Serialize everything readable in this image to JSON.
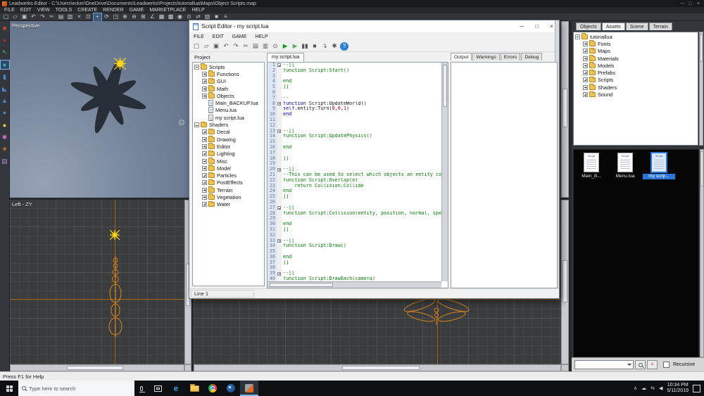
{
  "theme": {
    "accent": "#2f80d2",
    "wire": "#d9821c",
    "wire-dim": "#a06414",
    "sun": "#ffd61a",
    "comment": "#007a00",
    "keyword": "#0000a8",
    "number": "#b80000",
    "model": "#242a33"
  },
  "app": {
    "title": "Leadwerks Editor - C:\\Users\\ecker\\OneDrive\\Documents\\Leadwerks\\Projects\\tutoriallua\\Maps\\Object Scripts.map",
    "menu": [
      "FILE",
      "EDIT",
      "VIEW",
      "TOOLS",
      "CREATE",
      "RENDER",
      "GAME",
      "MARKETPLACE",
      "HELP"
    ],
    "window_controls": {
      "minimize": "─",
      "maximize": "□",
      "close": "×"
    },
    "status": "Press F1 for Help",
    "toolbar": [
      {
        "name": "new-icon",
        "glyph": "▢"
      },
      {
        "name": "open-icon",
        "glyph": "▱"
      },
      {
        "name": "save-icon",
        "glyph": "▣"
      },
      {
        "name": "undo-icon",
        "glyph": "↶"
      },
      {
        "name": "redo-icon",
        "glyph": "↷"
      },
      {
        "name": "cut-icon",
        "glyph": "✂"
      },
      {
        "name": "copy-icon",
        "glyph": "▤"
      },
      {
        "name": "paste-icon",
        "glyph": "▥"
      },
      {
        "name": "delete-icon",
        "glyph": "×"
      },
      {
        "name": "select-tool-icon",
        "glyph": "⊡"
      },
      {
        "name": "translate-tool-icon",
        "glyph": "+",
        "cls": "active"
      },
      {
        "name": "rotate-tool-icon",
        "glyph": "⟳"
      },
      {
        "name": "scale-tool-icon",
        "glyph": "◳"
      },
      {
        "name": "csg-add-icon",
        "glyph": "⊕"
      },
      {
        "name": "csg-subtract-icon",
        "glyph": "⊖"
      },
      {
        "name": "grid-snap-icon",
        "glyph": "⊞"
      },
      {
        "name": "angle-snap-icon",
        "glyph": "∠"
      },
      {
        "name": "grid-decrease-icon",
        "glyph": "▦"
      },
      {
        "name": "grid-increase-icon",
        "glyph": "▩"
      },
      {
        "name": "camera-tool-icon",
        "glyph": "◉"
      },
      {
        "name": "zoom-tool-icon",
        "glyph": "⊙"
      },
      {
        "name": "pan-tool-icon",
        "glyph": "⇄"
      },
      {
        "name": "wireframe-view-icon",
        "glyph": "▧"
      },
      {
        "name": "solid-view-icon",
        "glyph": "■"
      },
      {
        "name": "options-icon",
        "glyph": "≡"
      }
    ],
    "side_tools": [
      {
        "name": "create-box-tool",
        "glyph": "■",
        "color": "#c0453a"
      },
      {
        "name": "create-sphere-tool",
        "glyph": "●",
        "color": "#a33327"
      },
      {
        "name": "move-tool",
        "glyph": "↖",
        "color": "#49c46a"
      },
      {
        "name": "select-ball-tool",
        "glyph": "●",
        "color": "#35b6c9",
        "cls": "active"
      },
      {
        "name": "create-cylinder-tool",
        "glyph": "▮",
        "color": "#4a86d8"
      },
      {
        "name": "create-wedge-tool",
        "glyph": "◣",
        "color": "#4a86d8"
      },
      {
        "name": "create-cone-tool",
        "glyph": "▲",
        "color": "#4a86d8"
      },
      {
        "name": "create-capsule-tool",
        "glyph": "●",
        "color": "#4a86d8"
      },
      {
        "name": "create-light-tool",
        "glyph": "●",
        "color": "#f5d442"
      },
      {
        "name": "create-emitter-tool",
        "glyph": "✱",
        "color": "#d06cd0"
      },
      {
        "name": "create-sun-tool",
        "glyph": "☀",
        "color": "#f09030"
      },
      {
        "name": "attach-script-tool",
        "glyph": "▤",
        "color": "#b48ae0"
      }
    ]
  },
  "viewports": {
    "perspective_label": "Perspective",
    "left_label": "Left - ZY"
  },
  "script_editor": {
    "title": "Script Editor - my script.lua",
    "menu": [
      "FILE",
      "EDIT",
      "GAME",
      "HELP"
    ],
    "controls": {
      "minimize": "─",
      "maximize": "□",
      "close": "×"
    },
    "toolbar": [
      {
        "name": "new-script-icon",
        "glyph": "▢"
      },
      {
        "name": "open-script-icon",
        "glyph": "▱"
      },
      {
        "name": "save-script-icon",
        "glyph": "▣"
      },
      {
        "name": "undo-icon",
        "glyph": "↶"
      },
      {
        "name": "redo-icon",
        "glyph": "↷"
      },
      {
        "name": "cut-icon",
        "glyph": "✂"
      },
      {
        "name": "copy-icon",
        "glyph": "▤"
      },
      {
        "name": "paste-icon",
        "glyph": "▥"
      },
      {
        "name": "find-icon",
        "glyph": "⊙"
      },
      {
        "name": "run-icon",
        "glyph": "▶",
        "color": "#129612"
      },
      {
        "name": "debug-run-icon",
        "glyph": "▶",
        "color": "#51b651"
      },
      {
        "name": "pause-icon",
        "glyph": "▮▮",
        "color": "#555555"
      },
      {
        "name": "stop-icon",
        "glyph": "■",
        "color": "#555555"
      },
      {
        "name": "step-icon",
        "glyph": "↴",
        "color": "#50555c"
      },
      {
        "name": "options-gear-icon",
        "glyph": "✱",
        "color": "#50555c"
      },
      {
        "name": "help-icon",
        "glyph": "?",
        "cls": "round",
        "color": "#ffffff"
      }
    ],
    "project_panel": {
      "header": "Project",
      "tree": [
        {
          "label": "Scripts",
          "icon": "folder",
          "exp": "minus",
          "ind": "ind0"
        },
        {
          "label": "Functions",
          "icon": "folder",
          "exp": "plus",
          "ind": "ind1"
        },
        {
          "label": "GUI",
          "icon": "folder",
          "exp": "plus",
          "ind": "ind1"
        },
        {
          "label": "Math",
          "icon": "folder",
          "exp": "plus",
          "ind": "ind1"
        },
        {
          "label": "Objects",
          "icon": "folder",
          "exp": "plus",
          "ind": "ind1"
        },
        {
          "label": "Main_BACKUP.lua",
          "icon": "file",
          "exp": "none",
          "ind": "ind1"
        },
        {
          "label": "Menu.lua",
          "icon": "file",
          "exp": "none",
          "ind": "ind1"
        },
        {
          "label": "my script.lua",
          "icon": "file",
          "exp": "none",
          "ind": "ind1"
        },
        {
          "label": "Shaders",
          "icon": "folder",
          "exp": "minus",
          "ind": "ind0"
        },
        {
          "label": "Decal",
          "icon": "folder",
          "exp": "plus",
          "ind": "ind1"
        },
        {
          "label": "Drawing",
          "icon": "folder",
          "exp": "plus",
          "ind": "ind1"
        },
        {
          "label": "Editor",
          "icon": "folder",
          "exp": "plus",
          "ind": "ind1"
        },
        {
          "label": "Lighting",
          "icon": "folder",
          "exp": "plus",
          "ind": "ind1"
        },
        {
          "label": "Misc",
          "icon": "folder",
          "exp": "plus",
          "ind": "ind1"
        },
        {
          "label": "Model",
          "icon": "folder",
          "exp": "plus",
          "ind": "ind1"
        },
        {
          "label": "Particles",
          "icon": "folder",
          "exp": "plus",
          "ind": "ind1"
        },
        {
          "label": "PostEffects",
          "icon": "folder",
          "exp": "plus",
          "ind": "ind1"
        },
        {
          "label": "Terrain",
          "icon": "folder",
          "exp": "plus",
          "ind": "ind1"
        },
        {
          "label": "Vegetation",
          "icon": "folder",
          "exp": "plus",
          "ind": "ind1"
        },
        {
          "label": "Water",
          "icon": "folder",
          "exp": "plus",
          "ind": "ind1"
        }
      ]
    },
    "tab": "my script.lua",
    "output_tabs": [
      {
        "label": "Output",
        "cls": "active"
      },
      {
        "label": "Warnings",
        "cls": ""
      },
      {
        "label": "Errors",
        "cls": ""
      },
      {
        "label": "Debug",
        "cls": ""
      }
    ],
    "status": "Line 1",
    "code": {
      "lines": [
        {
          "n": 1,
          "fold": true,
          "seg": [
            {
              "c": "cm",
              "t": "--[["
            }
          ]
        },
        {
          "n": 2,
          "seg": [
            {
              "c": "cm",
              "t": "function Script:Start()"
            }
          ]
        },
        {
          "n": 3,
          "seg": []
        },
        {
          "n": 4,
          "seg": [
            {
              "c": "cm",
              "t": "end"
            }
          ]
        },
        {
          "n": 5,
          "seg": [
            {
              "c": "cm",
              "t": "]]"
            }
          ]
        },
        {
          "n": 6,
          "seg": []
        },
        {
          "n": 7,
          "seg": [
            {
              "c": "cm",
              "t": "--"
            }
          ]
        },
        {
          "n": 8,
          "fold": true,
          "seg": [
            {
              "c": "kw",
              "t": "function"
            },
            {
              "c": "pl",
              "t": " Script:UpdateWorld()"
            }
          ]
        },
        {
          "n": 9,
          "seg": [
            {
              "c": "kw",
              "t": "self"
            },
            {
              "c": "pl",
              "t": ".entity:Turn("
            },
            {
              "c": "nm",
              "t": "0"
            },
            {
              "c": "pl",
              "t": ","
            },
            {
              "c": "nm",
              "t": "0"
            },
            {
              "c": "pl",
              "t": ","
            },
            {
              "c": "nm",
              "t": "1"
            },
            {
              "c": "pl",
              "t": ")"
            }
          ]
        },
        {
          "n": 10,
          "seg": [
            {
              "c": "kw",
              "t": "end"
            }
          ]
        },
        {
          "n": 11,
          "seg": []
        },
        {
          "n": 12,
          "seg": []
        },
        {
          "n": 13,
          "fold": true,
          "seg": [
            {
              "c": "cm",
              "t": "--[["
            }
          ]
        },
        {
          "n": 14,
          "seg": [
            {
              "c": "cm",
              "t": "function Script:UpdatePhysics()"
            }
          ]
        },
        {
          "n": 15,
          "seg": []
        },
        {
          "n": 16,
          "seg": [
            {
              "c": "cm",
              "t": "end"
            }
          ]
        },
        {
          "n": 17,
          "seg": []
        },
        {
          "n": 18,
          "seg": [
            {
              "c": "cm",
              "t": "]]"
            }
          ]
        },
        {
          "n": 19,
          "seg": []
        },
        {
          "n": 20,
          "fold": true,
          "seg": [
            {
              "c": "cm",
              "t": "--[["
            }
          ]
        },
        {
          "n": 21,
          "seg": [
            {
              "c": "cm",
              "t": "--This can be used to select which objects an entity col"
            }
          ]
        },
        {
          "n": 22,
          "seg": [
            {
              "c": "cm",
              "t": "function Script:Overlap(e)"
            }
          ]
        },
        {
          "n": 23,
          "seg": [
            {
              "c": "cm",
              "t": "    return Collision:Collide"
            }
          ]
        },
        {
          "n": 24,
          "seg": [
            {
              "c": "cm",
              "t": "end"
            }
          ]
        },
        {
          "n": 25,
          "seg": [
            {
              "c": "cm",
              "t": "]]"
            }
          ]
        },
        {
          "n": 26,
          "seg": []
        },
        {
          "n": 27,
          "fold": true,
          "seg": [
            {
              "c": "cm",
              "t": "--[["
            }
          ]
        },
        {
          "n": 28,
          "seg": [
            {
              "c": "cm",
              "t": "function Script:Collision(entity, position, normal, spee"
            }
          ]
        },
        {
          "n": 29,
          "seg": []
        },
        {
          "n": 30,
          "seg": [
            {
              "c": "cm",
              "t": "end"
            }
          ]
        },
        {
          "n": 31,
          "seg": [
            {
              "c": "cm",
              "t": "]]"
            }
          ]
        },
        {
          "n": 32,
          "seg": []
        },
        {
          "n": 33,
          "fold": true,
          "seg": [
            {
              "c": "cm",
              "t": "--[["
            }
          ]
        },
        {
          "n": 34,
          "seg": [
            {
              "c": "cm",
              "t": "function Script:Draw()"
            }
          ]
        },
        {
          "n": 35,
          "seg": []
        },
        {
          "n": 36,
          "seg": [
            {
              "c": "cm",
              "t": "end"
            }
          ]
        },
        {
          "n": 37,
          "seg": [
            {
              "c": "cm",
              "t": "]]"
            }
          ]
        },
        {
          "n": 38,
          "seg": []
        },
        {
          "n": 39,
          "fold": true,
          "seg": [
            {
              "c": "cm",
              "t": "--[["
            }
          ]
        },
        {
          "n": 40,
          "seg": [
            {
              "c": "cm",
              "t": "function Script:DrawEach(camera)"
            }
          ]
        }
      ]
    }
  },
  "assets_panel": {
    "tabs": [
      {
        "label": "Objects",
        "cls": ""
      },
      {
        "label": "Assets",
        "cls": "active"
      },
      {
        "label": "Scene",
        "cls": ""
      },
      {
        "label": "Terrain",
        "cls": ""
      }
    ],
    "tree": [
      {
        "label": "tutoriallua",
        "icon": "folder-open",
        "exp": "minus",
        "ind": "ind0"
      },
      {
        "label": "Fonts",
        "icon": "folder",
        "exp": "plus",
        "ind": "ind1"
      },
      {
        "label": "Maps",
        "icon": "folder",
        "exp": "plus",
        "ind": "ind1"
      },
      {
        "label": "Materials",
        "icon": "folder",
        "exp": "plus",
        "ind": "ind1"
      },
      {
        "label": "Models",
        "icon": "folder",
        "exp": "plus",
        "ind": "ind1"
      },
      {
        "label": "Prefabs",
        "icon": "folder",
        "exp": "plus",
        "ind": "ind1"
      },
      {
        "label": "Scripts",
        "icon": "folder",
        "exp": "plus",
        "ind": "ind1"
      },
      {
        "label": "Shaders",
        "icon": "folder",
        "exp": "plus",
        "ind": "ind1"
      },
      {
        "label": "Sound",
        "icon": "folder",
        "exp": "plus",
        "ind": "ind1"
      }
    ],
    "files": [
      {
        "label": "Main_B...",
        "kind": "Script",
        "cls": ""
      },
      {
        "label": "Menu.lua",
        "kind": "Script",
        "cls": ""
      },
      {
        "label": "my scrip...",
        "kind": "Script",
        "cls": "selected"
      }
    ],
    "search_value": "",
    "recursive_label": "Recursive"
  },
  "taskbar": {
    "search_placeholder": "Type here to search",
    "tray_icons": [
      {
        "name": "tray-chevron-icon",
        "glyph": "∧"
      },
      {
        "name": "onedrive-icon",
        "glyph": "☁"
      },
      {
        "name": "network-icon",
        "glyph": "⇆"
      },
      {
        "name": "volume-icon",
        "glyph": "◀"
      }
    ],
    "time": "10:34 PM",
    "date": "5/11/2019"
  }
}
